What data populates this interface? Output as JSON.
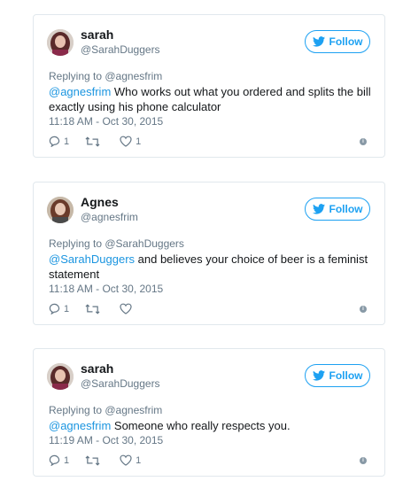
{
  "follow_label": "Follow",
  "tweets": [
    {
      "name": "sarah",
      "handle": "@SarahDuggers",
      "replying_to": "Replying to @agnesfrim",
      "mention": "@agnesfrim",
      "text": " Who works out what you ordered and splits the bill exactly using his phone calculator",
      "timestamp": "11:18 AM - Oct 30, 2015",
      "reply_count": "1",
      "retweet_count": "",
      "like_count": "1"
    },
    {
      "name": "Agnes",
      "handle": "@agnesfrim",
      "replying_to": "Replying to @SarahDuggers",
      "mention": "@SarahDuggers",
      "text": " and believes your choice of beer is a feminist statement",
      "timestamp": "11:18 AM - Oct 30, 2015",
      "reply_count": "1",
      "retweet_count": "",
      "like_count": ""
    },
    {
      "name": "sarah",
      "handle": "@SarahDuggers",
      "replying_to": "Replying to @agnesfrim",
      "mention": "@agnesfrim",
      "text": " Someone who really respects you.",
      "timestamp": "11:19 AM - Oct 30, 2015",
      "reply_count": "1",
      "retweet_count": "",
      "like_count": "1"
    }
  ],
  "colors": {
    "accent": "#1da1f2",
    "mention": "#1b95e0",
    "muted": "#657786",
    "border": "#e1e8ed"
  }
}
